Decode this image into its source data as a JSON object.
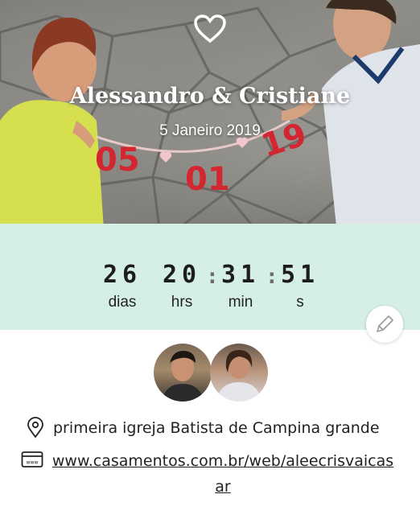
{
  "hero": {
    "couple_name": "Alessandro & Cristiane",
    "date": "5 Janeiro 2019",
    "sign_numbers": [
      "05",
      "01",
      "19"
    ]
  },
  "countdown": {
    "units": [
      {
        "value": "26",
        "label": "dias"
      },
      {
        "value": "20",
        "label": "hrs"
      },
      {
        "value": "31",
        "label": "min"
      },
      {
        "value": "51",
        "label": "s"
      }
    ],
    "separator": ":"
  },
  "location": {
    "icon": "map-pin-icon",
    "text": "primeira igreja Batista de Campina grande"
  },
  "website": {
    "icon": "browser-www-icon",
    "url": "www.casamentos.com.br/web/aleecrisvaicasar"
  },
  "colors": {
    "band": "#d6efe6",
    "text": "#222222",
    "sign_red": "#d32630"
  }
}
